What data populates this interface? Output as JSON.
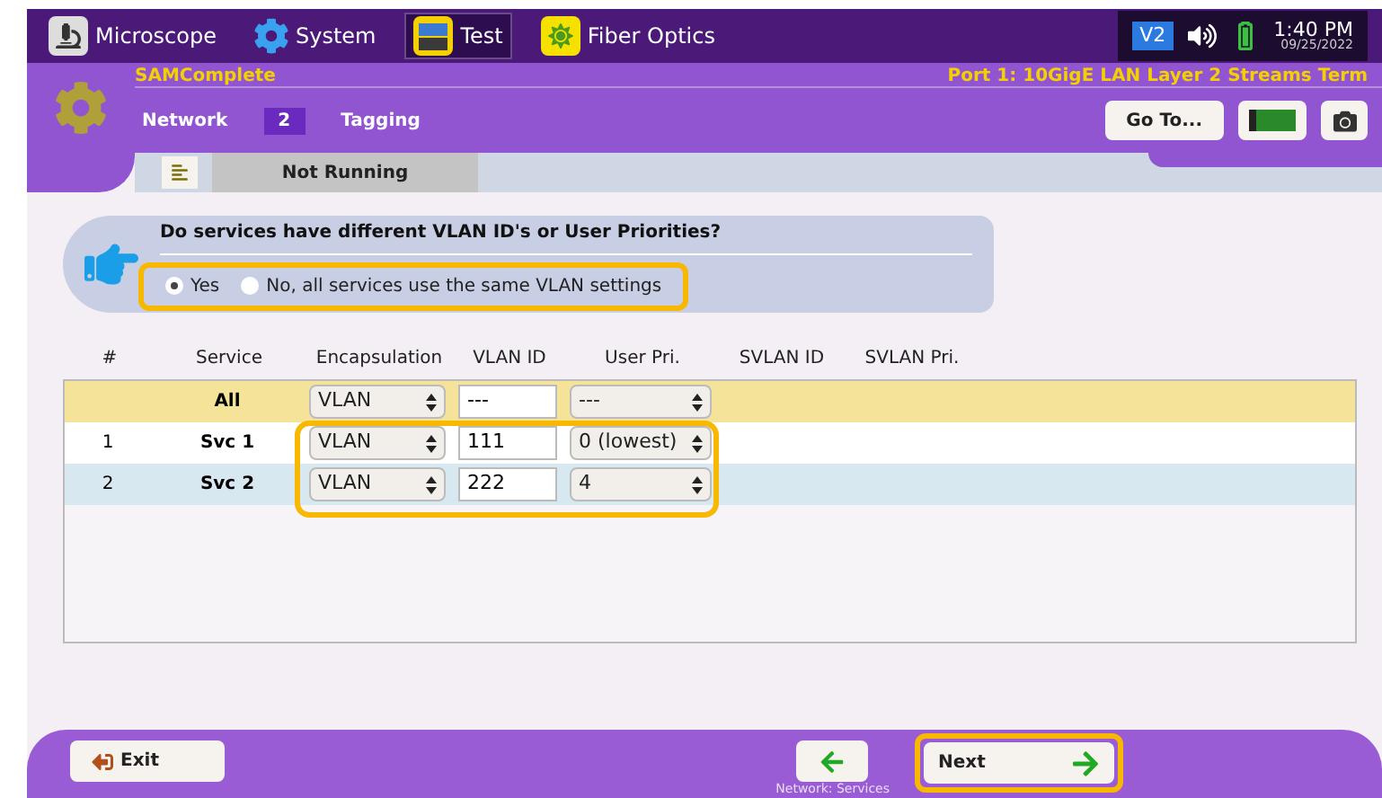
{
  "top_bar": {
    "apps": [
      {
        "label": "Microscope",
        "selected": false
      },
      {
        "label": "System",
        "selected": false
      },
      {
        "label": "Test",
        "selected": true
      },
      {
        "label": "Fiber Optics",
        "selected": false
      }
    ],
    "badge": "V2",
    "time": "1:40 PM",
    "date": "09/25/2022"
  },
  "header": {
    "title": "SAMComplete",
    "port": "Port 1: 10GigE LAN Layer 2 Streams Term",
    "steps": [
      {
        "label": "Network",
        "selected": false
      },
      {
        "label": "2",
        "selected": true
      },
      {
        "label": "Tagging",
        "selected": false
      }
    ],
    "goto": "Go To...",
    "status": "Not Running"
  },
  "question": {
    "text": "Do services have different VLAN ID's or User Priorities?",
    "highlighted": true,
    "options": [
      {
        "label": "Yes",
        "selected": true
      },
      {
        "label": "No, all services use the same VLAN settings",
        "selected": false
      }
    ]
  },
  "table": {
    "columns": [
      "#",
      "Service",
      "Encapsulation",
      "VLAN ID",
      "User Pri.",
      "SVLAN ID",
      "SVLAN Pri."
    ],
    "highlighted": true,
    "rows": [
      {
        "kind": "all",
        "index": "",
        "service": "All",
        "encapsulation": "VLAN",
        "vlan_id": "---",
        "user_pri": "---"
      },
      {
        "kind": "service",
        "index": "1",
        "service": "Svc 1",
        "encapsulation": "VLAN",
        "vlan_id": "111",
        "user_pri": "0 (lowest)"
      },
      {
        "kind": "service",
        "index": "2",
        "service": "Svc 2",
        "encapsulation": "VLAN",
        "vlan_id": "222",
        "user_pri": "4"
      }
    ]
  },
  "footer": {
    "exit": "Exit",
    "back_caption": "Network: Services",
    "next": "Next",
    "next_highlighted": true
  }
}
